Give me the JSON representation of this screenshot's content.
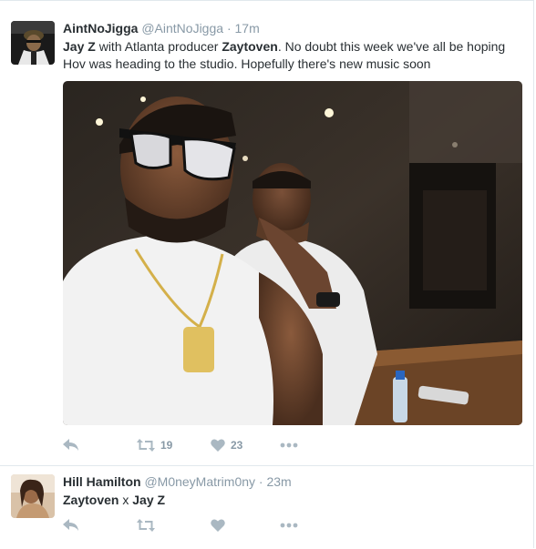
{
  "tweets": [
    {
      "name": "AintNoJigga",
      "handle": "@AintNoJigga",
      "separator": "·",
      "time": "17m",
      "text_parts": [
        {
          "t": "Jay Z",
          "b": true
        },
        {
          "t": " with Atlanta producer ",
          "b": false
        },
        {
          "t": "Zaytoven",
          "b": true
        },
        {
          "t": ". No doubt this week we've all be hoping Hov was heading to the studio. Hopefully there's new music soon",
          "b": false
        }
      ],
      "retweets": "19",
      "likes": "23"
    },
    {
      "name": "Hill Hamilton",
      "handle": "@M0neyMatrim0ny",
      "separator": "·",
      "time": "23m",
      "text_parts": [
        {
          "t": "Zaytoven",
          "b": true
        },
        {
          "t": " x ",
          "b": false
        },
        {
          "t": "Jay Z",
          "b": true
        }
      ],
      "retweets": "",
      "likes": ""
    }
  ],
  "icons": {
    "reply": "reply-icon",
    "retweet": "retweet-icon",
    "like": "heart-icon",
    "more": "more-icon"
  },
  "colors": {
    "action_gray": "#aab8c2",
    "secondary_text": "#8899a6",
    "border": "#e1e8ed"
  }
}
